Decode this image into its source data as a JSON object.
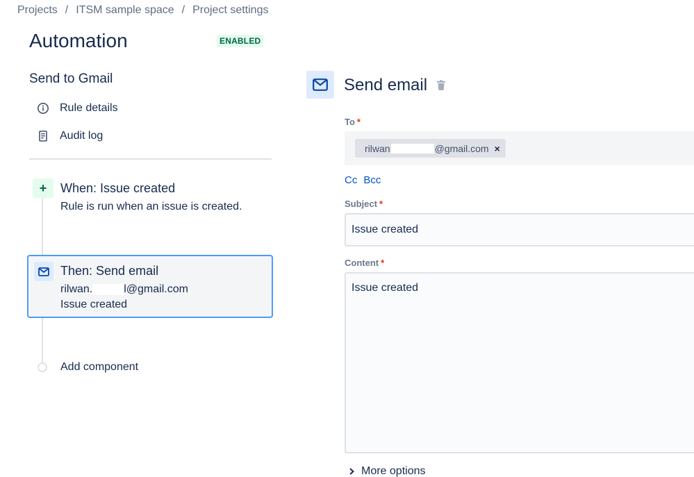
{
  "breadcrumb": {
    "items": [
      "Projects",
      "ITSM sample space",
      "Project settings"
    ],
    "separator": "/"
  },
  "page": {
    "title": "Automation",
    "status": "ENABLED"
  },
  "sidebar": {
    "rule_name": "Send to Gmail",
    "links": [
      {
        "label": "Rule details",
        "icon": "info-icon"
      },
      {
        "label": "Audit log",
        "icon": "document-icon"
      }
    ]
  },
  "rule": {
    "trigger": {
      "badge": "+",
      "title": "When: Issue created",
      "description": "Rule is run when an issue is created."
    },
    "action": {
      "title": "Then: Send email",
      "recipient_prefix": "rilwan.",
      "recipient_suffix": "l@gmail.com",
      "subject": "Issue created"
    },
    "add_component": "Add component"
  },
  "panel": {
    "title": "Send email",
    "to": {
      "label": "To",
      "required": "*",
      "chip_prefix": "rilwan",
      "chip_suffix": "@gmail.com",
      "chip_remove": "×"
    },
    "cc_label": "Cc",
    "bcc_label": "Bcc",
    "subject": {
      "label": "Subject",
      "required": "*",
      "value": "Issue created"
    },
    "content": {
      "label": "Content",
      "required": "*",
      "value": "Issue created"
    },
    "more_options": "More options"
  },
  "colors": {
    "accent": "#0052cc",
    "selected_border": "#4c9aff",
    "enabled_bg": "#e3fcef",
    "enabled_text": "#006644",
    "required": "#de350b"
  }
}
